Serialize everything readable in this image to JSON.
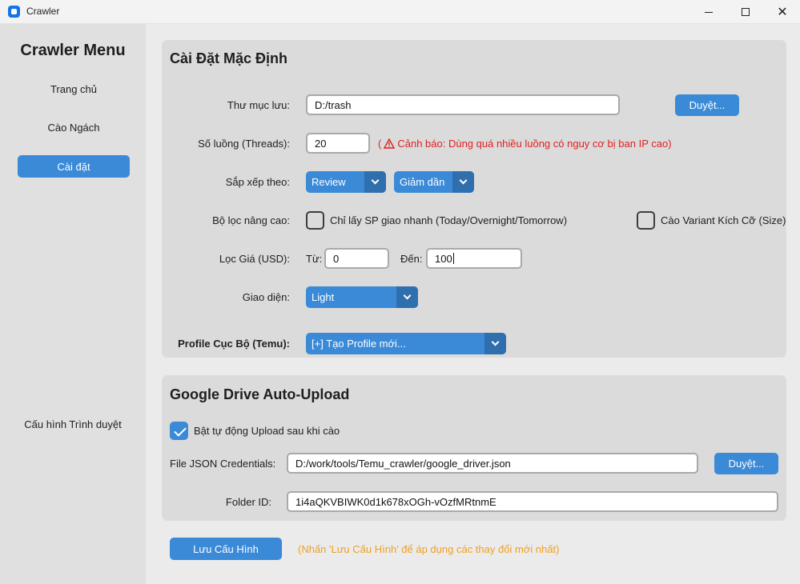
{
  "window": {
    "title": "Crawler"
  },
  "sidebar": {
    "title": "Crawler Menu",
    "items": [
      {
        "label": "Trang chủ",
        "active": false
      },
      {
        "label": "Cào Ngách",
        "active": false
      },
      {
        "label": "Cài đặt",
        "active": true
      }
    ],
    "browser_config": "Cấu hình Trình duyệt"
  },
  "defaults": {
    "title": "Cài Đặt Mặc Định",
    "folder": {
      "label": "Thư mục lưu:",
      "value": "D:/trash",
      "browse": "Duyệt..."
    },
    "threads": {
      "label": "Số luồng (Threads):",
      "value": "20",
      "warning_open": "(",
      "warning": "Cảnh báo: Dùng quá nhiều luồng có nguy cơ bị ban IP cao)"
    },
    "sort": {
      "label": "Sắp xếp theo:",
      "field": "Review",
      "order": "Giảm dần"
    },
    "filter": {
      "label": "Bộ lọc nâng cao:",
      "fast_ship": "Chỉ lấy SP giao nhanh (Today/Overnight/Tomorrow)",
      "fast_ship_checked": false,
      "variant_size": "Cào Variant Kích Cỡ (Size)",
      "variant_size_checked": false
    },
    "price": {
      "label": "Lọc Giá (USD):",
      "from_label": "Từ:",
      "from": "0",
      "to_label": "Đến:",
      "to": "100"
    },
    "theme": {
      "label": "Giao diện:",
      "value": "Light"
    },
    "profile": {
      "label": "Profile Cục Bộ (Temu):",
      "value": "[+] Tạo Profile mới..."
    }
  },
  "gdrive": {
    "title": "Google Drive Auto-Upload",
    "auto_upload": {
      "label": "Bật tự động Upload sau khi cào",
      "checked": true
    },
    "credentials": {
      "label": "File JSON Credentials:",
      "value": "D:/work/tools/Temu_crawler/google_driver.json",
      "browse": "Duyệt..."
    },
    "folder_id": {
      "label": "Folder ID:",
      "value": "1i4aQKVBIWK0d1k678xOGh-vOzfMRtnmE"
    }
  },
  "footer": {
    "save": "Lưu Cấu Hình",
    "hint": "(Nhấn 'Lưu Cấu Hình' để áp dụng các thay đổi mới nhất)"
  },
  "colors": {
    "accent": "#3a8ad8",
    "accent_dark": "#2f6fad",
    "warning": "#e02020",
    "hint": "#f0a020"
  }
}
